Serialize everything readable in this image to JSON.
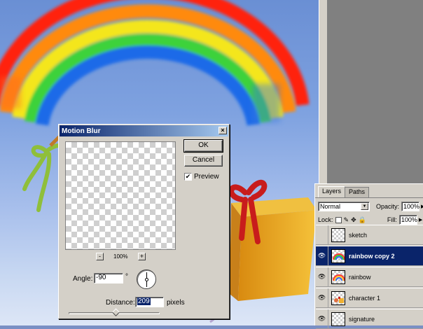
{
  "dialog": {
    "title": "Motion Blur",
    "ok_label": "OK",
    "cancel_label": "Cancel",
    "preview_label": "Preview",
    "preview_checked": true,
    "zoom_out": "-",
    "zoom_in": "+",
    "zoom_level": "100%",
    "angle_label": "Angle:",
    "angle_value": "-90",
    "angle_unit": "°",
    "distance_label": "Distance:",
    "distance_value": "209",
    "distance_unit": "pixels",
    "close_glyph": "×"
  },
  "layers_panel": {
    "tabs": [
      "Layers",
      "Paths"
    ],
    "blend_mode": "Normal",
    "opacity_label": "Opacity:",
    "opacity_value": "100%",
    "lock_label": "Lock:",
    "fill_label": "Fill:",
    "fill_value": "100%",
    "layers": [
      {
        "name": "sketch",
        "visible": false,
        "active": false
      },
      {
        "name": "rainbow copy 2",
        "visible": true,
        "active": true
      },
      {
        "name": "rainbow",
        "visible": true,
        "active": false
      },
      {
        "name": "character 1",
        "visible": true,
        "active": false
      },
      {
        "name": "signature",
        "visible": true,
        "active": false
      }
    ]
  },
  "colors": {
    "selection": "#0a246a",
    "dialog_bg": "#d4d0c8"
  }
}
